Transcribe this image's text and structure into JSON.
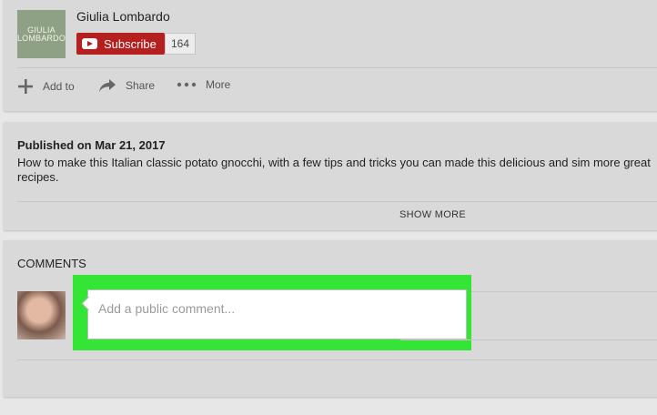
{
  "channel": {
    "thumb_line1": "GIULIA",
    "thumb_line2": "LOMBARDO",
    "name": "Giulia Lombardo",
    "subscribe_label": "Subscribe",
    "subscriber_count": "164"
  },
  "actions": {
    "add_to": "Add to",
    "share": "Share",
    "more": "More"
  },
  "description": {
    "published": "Published on Mar 21, 2017",
    "text": "How to make this Italian classic potato gnocchi, with a few tips and tricks you can made this delicious and sim more great recipes.",
    "show_more": "SHOW MORE"
  },
  "comments": {
    "title": "COMMENTS",
    "placeholder": "Add a public comment..."
  },
  "colors": {
    "subscribe": "#b5201f",
    "highlight": "#35e535",
    "background": "#d9d9d9"
  }
}
